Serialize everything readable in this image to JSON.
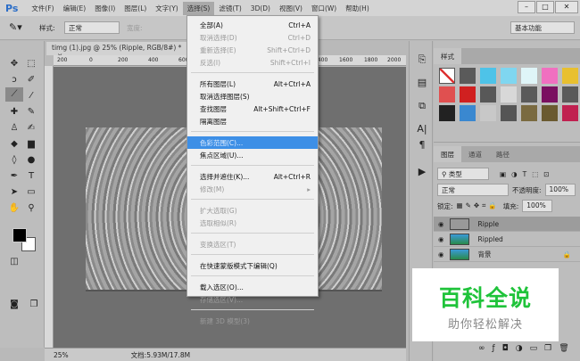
{
  "app": {
    "logo": "Ps"
  },
  "menubar": [
    {
      "label": "文件(F)"
    },
    {
      "label": "编辑(E)"
    },
    {
      "label": "图像(I)"
    },
    {
      "label": "图层(L)"
    },
    {
      "label": "文字(Y)"
    },
    {
      "label": "选择(S)",
      "open": true
    },
    {
      "label": "滤镜(T)"
    },
    {
      "label": "3D(D)"
    },
    {
      "label": "视图(V)"
    },
    {
      "label": "窗口(W)"
    },
    {
      "label": "帮助(H)"
    }
  ],
  "window_controls": {
    "minimize": "–",
    "maximize": "□",
    "close": "✕"
  },
  "options": {
    "style_label": "样式:",
    "style_value": "正常",
    "extra_label": "宽度:",
    "workspace": "基本功能"
  },
  "document": {
    "tab": "timg (1).jpg @ 25% (Ripple, RGB/8#) *",
    "close": "×",
    "ruler_ticks": [
      "200",
      "0",
      "200",
      "400",
      "600",
      "1400",
      "1600",
      "1800",
      "2000"
    ]
  },
  "status": {
    "zoom": "25%",
    "doc": "文档:5.93M/17.8M"
  },
  "select_menu": [
    {
      "label": "全部(A)",
      "shortcut": "Ctrl+A"
    },
    {
      "label": "取消选择(D)",
      "shortcut": "Ctrl+D",
      "disabled": true
    },
    {
      "label": "重新选择(E)",
      "shortcut": "Shift+Ctrl+D",
      "disabled": true
    },
    {
      "label": "反选(I)",
      "shortcut": "Shift+Ctrl+I",
      "disabled": true
    },
    {
      "sep": true
    },
    {
      "label": "所有图层(L)",
      "shortcut": "Alt+Ctrl+A"
    },
    {
      "label": "取消选择图层(S)",
      "shortcut": ""
    },
    {
      "label": "查找图层",
      "shortcut": "Alt+Shift+Ctrl+F"
    },
    {
      "label": "隔离图层",
      "shortcut": ""
    },
    {
      "sep": true
    },
    {
      "label": "色彩范围(C)...",
      "shortcut": "",
      "highlighted": true
    },
    {
      "label": "焦点区域(U)...",
      "shortcut": ""
    },
    {
      "sep": true
    },
    {
      "label": "选择并遮住(K)...",
      "shortcut": "Alt+Ctrl+R"
    },
    {
      "label": "修改(M)",
      "shortcut": "▸",
      "disabled": true
    },
    {
      "sep": true
    },
    {
      "label": "扩大选取(G)",
      "shortcut": "",
      "disabled": true
    },
    {
      "label": "选取相似(R)",
      "shortcut": "",
      "disabled": true
    },
    {
      "sep": true
    },
    {
      "label": "变换选区(T)",
      "shortcut": "",
      "disabled": true
    },
    {
      "sep": true
    },
    {
      "label": "在快速蒙版模式下编辑(Q)",
      "shortcut": ""
    },
    {
      "sep": true
    },
    {
      "label": "载入选区(O)...",
      "shortcut": ""
    },
    {
      "label": "存储选区(V)...",
      "shortcut": "",
      "disabled": true
    },
    {
      "sep": true
    },
    {
      "label": "新建 3D 模型(3)",
      "shortcut": "",
      "disabled": true
    }
  ],
  "styles_panel": {
    "tab": "样式",
    "swatches": [
      "#ffffff",
      "#5a5a5a",
      "#4ec3e8",
      "#7fd6f0",
      "#dff5f8",
      "#f070c0",
      "#e8c030",
      "#e05050",
      "#d02020",
      "#585858",
      "#d8d8d8",
      "#5a5a5a",
      "#7a1060",
      "#5a5a5a",
      "#222222",
      "#3a88d0",
      "#c8c8c8",
      "#555555",
      "#7a6a40",
      "#6a5a30",
      "#c02050"
    ]
  },
  "layers_panel": {
    "tabs": [
      "图层",
      "通道",
      "路径"
    ],
    "filter": "类型",
    "blend": "正常",
    "opacity_label": "不透明度:",
    "opacity": "100%",
    "lock_label": "锁定:",
    "fill_label": "填充:",
    "fill": "100%",
    "layers": [
      {
        "name": "Ripple",
        "active": true
      },
      {
        "name": "Rippled"
      },
      {
        "name": "背景",
        "locked": true
      }
    ]
  },
  "watermark": {
    "title": "百科全说",
    "subtitle": "助你轻松解决"
  }
}
